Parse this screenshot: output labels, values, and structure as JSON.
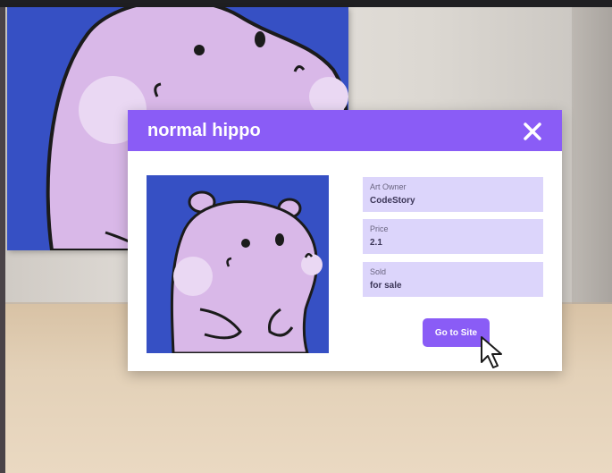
{
  "modal": {
    "title": "normal hippo",
    "fields": [
      {
        "label": "Art Owner",
        "value": "CodeStory"
      },
      {
        "label": "Price",
        "value": "2.1"
      },
      {
        "label": "Sold",
        "value": "for sale"
      }
    ],
    "go_button_label": "Go to Site"
  },
  "icons": {
    "close": "close-icon",
    "cursor": "mouse-pointer-icon"
  },
  "colors": {
    "accent": "#8a5cf6",
    "field_bg": "#dcd5fb",
    "artwork_bg": "#3650c4",
    "hippo": "#d9b8e8"
  }
}
